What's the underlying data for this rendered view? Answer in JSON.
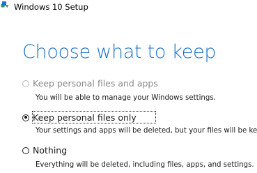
{
  "window": {
    "title": "Windows 10 Setup",
    "icon": "windows-setup-icon"
  },
  "page": {
    "heading": "Choose what to keep"
  },
  "options": [
    {
      "label": "Keep personal files and apps",
      "description": "You will be able to manage your Windows settings.",
      "selected": false,
      "enabled": false
    },
    {
      "label": "Keep personal files only",
      "description": "Your settings and apps will be deleted, but your files will be kept.",
      "selected": true,
      "enabled": true
    },
    {
      "label": "Nothing",
      "description": "Everything will be deleted, including files, apps, and settings.",
      "selected": false,
      "enabled": true
    }
  ],
  "colors": {
    "heading": "#1a6fc7",
    "disabled_text": "#8a8a8a",
    "icon_green": "#2e9a4e",
    "icon_blue": "#1f6fd1"
  }
}
